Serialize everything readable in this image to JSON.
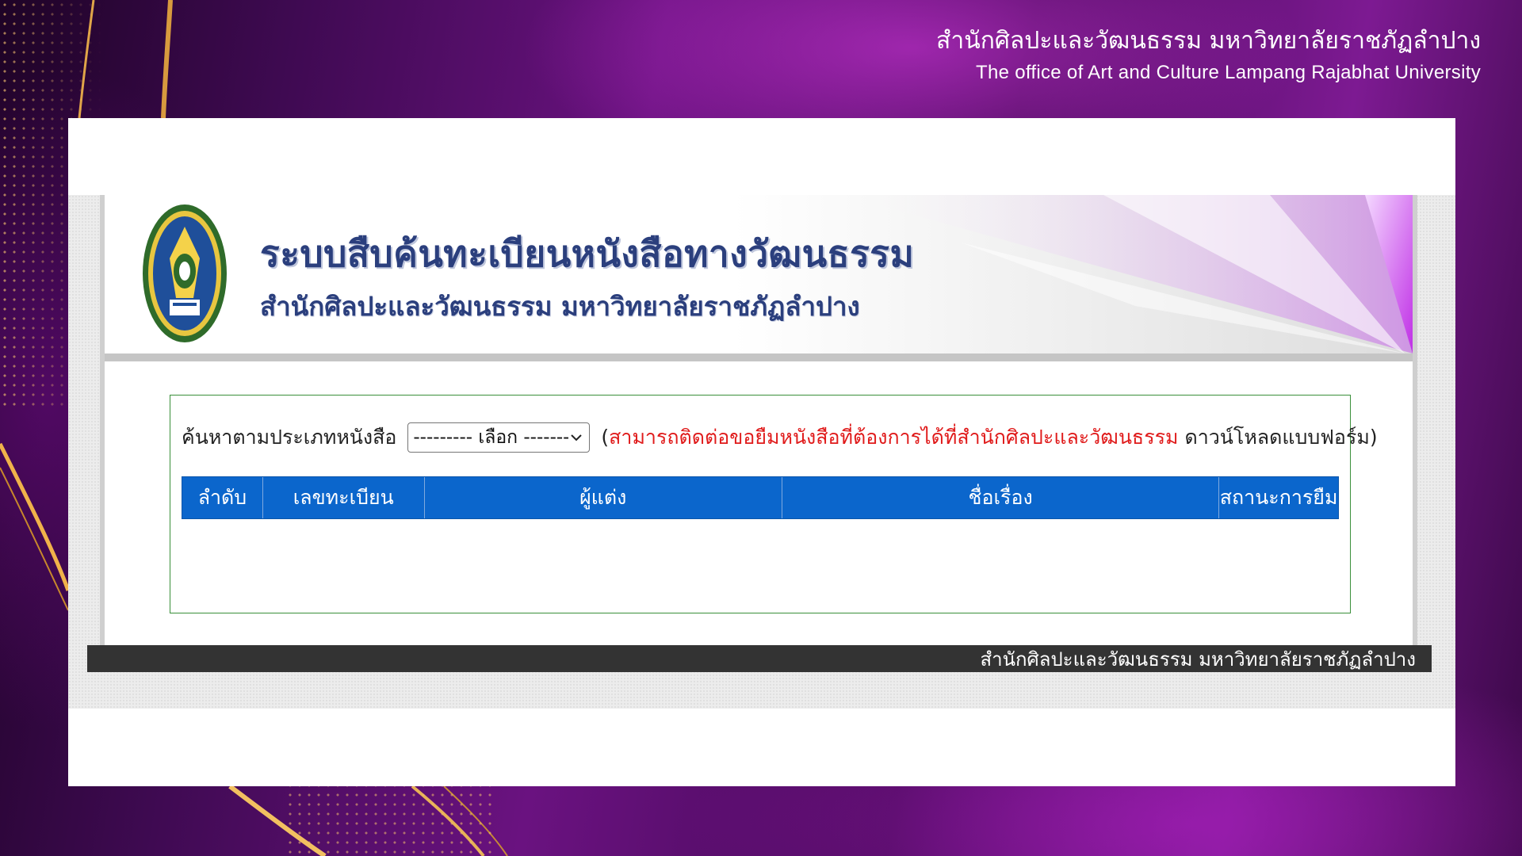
{
  "office_header": {
    "thai": "สำนักศิลปะและวัฒนธรรม มหาวิทยาลัยราชภัฏลำปาง",
    "english": "The office of Art and Culture Lampang Rajabhat University"
  },
  "banner": {
    "title": "ระบบสืบค้นทะเบียนหนังสือทางวัฒนธรรม",
    "subtitle": "สำนักศิลปะและวัฒนธรรม มหาวิทยาลัยราชภัฏลำปาง",
    "seal_icon": "university-seal-icon"
  },
  "search": {
    "label": "ค้นหาตามประเภทหนังสือ",
    "select_value": "--------- เลือก --------",
    "note_open": "(",
    "note_red": "สามารถติดต่อขอยืมหนังสือที่ต้องการได้ที่สำนักศิลปะและวัฒนธรรม",
    "note_link": "ดาวน์โหลดแบบฟอร์ม",
    "note_close": ")"
  },
  "table": {
    "columns": [
      "ลำดับ",
      "เลขทะเบียน",
      "ผู้แต่ง",
      "ชื่อเรื่อง",
      "สถานะการยืม"
    ]
  },
  "footer": {
    "text": "สำนักศิลปะและวัฒนธรรม  มหาวิทยาลัยราชภัฏลำปาง"
  },
  "colors": {
    "table_header": "#0b66cc",
    "note_red": "#e01b1b",
    "banner_title": "#2b3f7d",
    "footer_bg": "#333333",
    "box_border": "#3a8f3a"
  }
}
